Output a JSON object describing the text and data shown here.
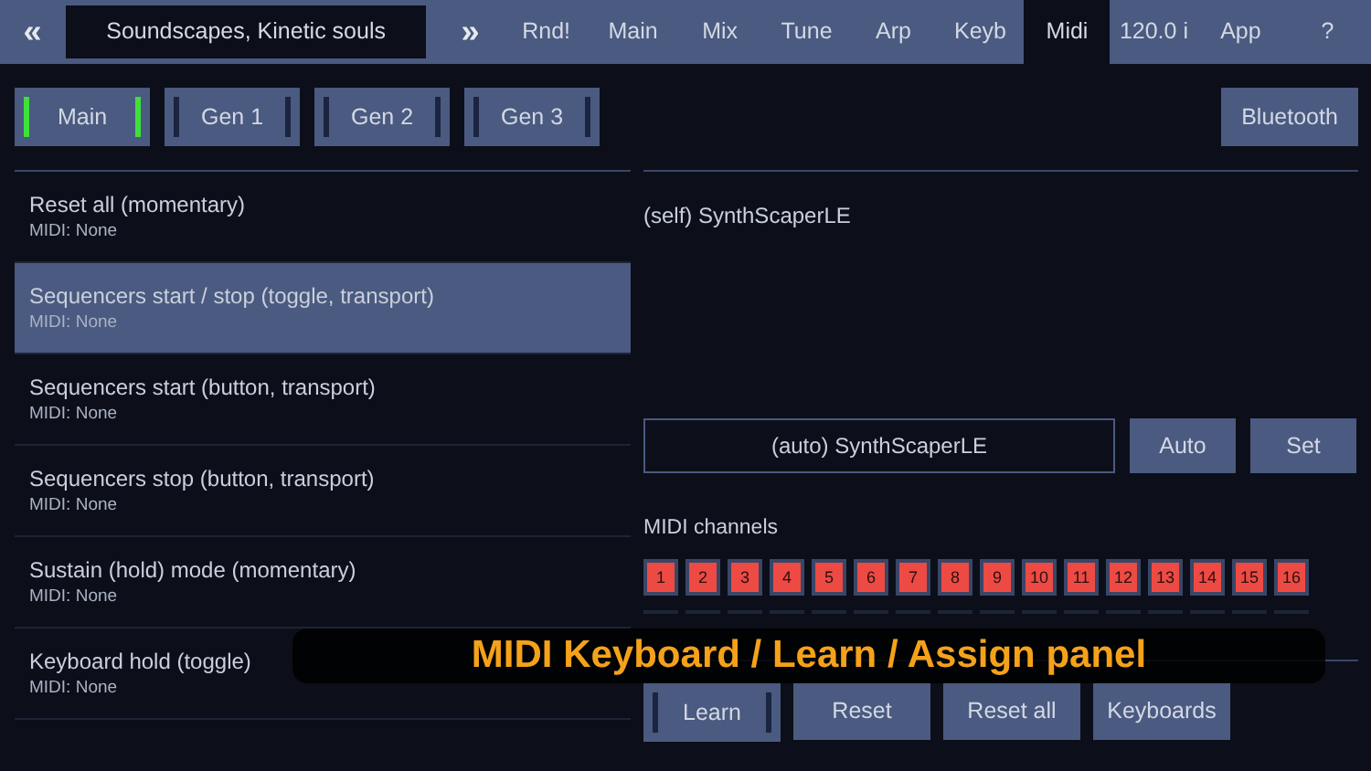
{
  "top_bar": {
    "prev": "«",
    "preset": "Soundscapes, Kinetic souls",
    "next": "»",
    "tabs": [
      {
        "label": "Rnd!",
        "selected": false
      },
      {
        "label": "Main",
        "selected": false
      },
      {
        "label": "Mix",
        "selected": false
      },
      {
        "label": "Tune",
        "selected": false
      },
      {
        "label": "Arp",
        "selected": false
      },
      {
        "label": "Keyb",
        "selected": false
      },
      {
        "label": "Midi",
        "selected": true
      },
      {
        "label": "120.0 i",
        "selected": false
      },
      {
        "label": "App",
        "selected": false
      },
      {
        "label": "?",
        "selected": false
      }
    ]
  },
  "sections": [
    {
      "label": "Main",
      "on": true
    },
    {
      "label": "Gen 1",
      "on": false
    },
    {
      "label": "Gen 2",
      "on": false
    },
    {
      "label": "Gen 3",
      "on": false
    }
  ],
  "bluetooth": "Bluetooth",
  "assignments": [
    {
      "title": "Reset all (momentary)",
      "midi": "MIDI: None",
      "selected": false
    },
    {
      "title": "Sequencers start / stop (toggle, transport)",
      "midi": "MIDI: None",
      "selected": true
    },
    {
      "title": "Sequencers start (button, transport)",
      "midi": "MIDI: None",
      "selected": false
    },
    {
      "title": "Sequencers stop (button, transport)",
      "midi": "MIDI: None",
      "selected": false
    },
    {
      "title": "Sustain (hold) mode (momentary)",
      "midi": "MIDI: None",
      "selected": false
    },
    {
      "title": "Keyboard hold (toggle)",
      "midi": "MIDI: None",
      "selected": false
    }
  ],
  "device": "(self) SynthScaperLE",
  "port_field": "(auto) SynthScaperLE",
  "port_buttons": [
    "Auto",
    "Set"
  ],
  "channels_label": "MIDI channels",
  "channels": [
    {
      "label": "1",
      "on": true
    },
    {
      "label": "2",
      "on": true
    },
    {
      "label": "3",
      "on": true
    },
    {
      "label": "4",
      "on": true
    },
    {
      "label": "5",
      "on": true
    },
    {
      "label": "6",
      "on": true
    },
    {
      "label": "7",
      "on": true
    },
    {
      "label": "8",
      "on": true
    },
    {
      "label": "9",
      "on": true
    },
    {
      "label": "10",
      "on": true
    },
    {
      "label": "11",
      "on": true
    },
    {
      "label": "12",
      "on": true
    },
    {
      "label": "13",
      "on": true
    },
    {
      "label": "14",
      "on": true
    },
    {
      "label": "15",
      "on": true
    },
    {
      "label": "16",
      "on": true
    }
  ],
  "bottom_buttons": [
    {
      "label": "Learn",
      "kind": "toggle",
      "on": false
    },
    {
      "label": "Reset",
      "kind": "plain"
    },
    {
      "label": "Reset all",
      "kind": "plain"
    },
    {
      "label": "Keyboards",
      "kind": "plain"
    }
  ],
  "caption": "MIDI Keyboard / Learn / Assign panel"
}
